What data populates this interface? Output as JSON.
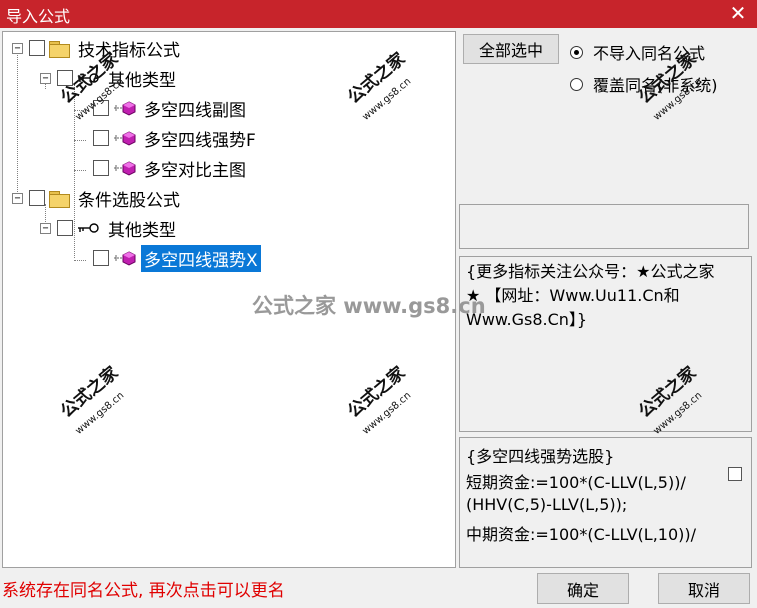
{
  "window": {
    "title": "导入公式",
    "close_glyph": "✕"
  },
  "tree": {
    "nodes": [
      {
        "label": "技术指标公式",
        "icon": "folder-icon",
        "expander": "−"
      },
      {
        "label": "其他类型",
        "icon": "key-icon",
        "expander": "−"
      },
      {
        "label": "多空四线副图",
        "icon": "formula-icon"
      },
      {
        "label": "多空四线强势F",
        "icon": "formula-icon"
      },
      {
        "label": "多空对比主图",
        "icon": "formula-icon"
      },
      {
        "label": "条件选股公式",
        "icon": "folder-icon",
        "expander": "−"
      },
      {
        "label": "其他类型",
        "icon": "key-icon",
        "expander": "−"
      },
      {
        "label": "多空四线强势X",
        "icon": "formula-icon",
        "selected": true
      }
    ]
  },
  "buttons": {
    "select_all": "全部选中",
    "ok": "确定",
    "cancel": "取消"
  },
  "options": {
    "no_import_same_name": "不导入同名公式",
    "overwrite_same_name": "覆盖同名(非系统)",
    "selected": "no_import_same_name"
  },
  "description": "{更多指标关注公众号：★公式之家★ 【网址：Www.Uu11.Cn和Www.Gs8.Cn】}",
  "code": {
    "lines": [
      "{多空四线强势选股}",
      "短期资金:=100*(C-LLV(L,5))/",
      "(HHV(C,5)-LLV(L,5));",
      "中期资金:=100*(C-LLV(L,10))/"
    ]
  },
  "status": "系统存在同名公式, 再次点击可以更名",
  "watermarks": {
    "brand": "公式之家",
    "url": "www.gs8.cn",
    "center": "公式之家 www.gs8.cn"
  },
  "colors": {
    "titlebar": "#c7242b",
    "selection": "#0a78d7",
    "status": "#e00000"
  }
}
